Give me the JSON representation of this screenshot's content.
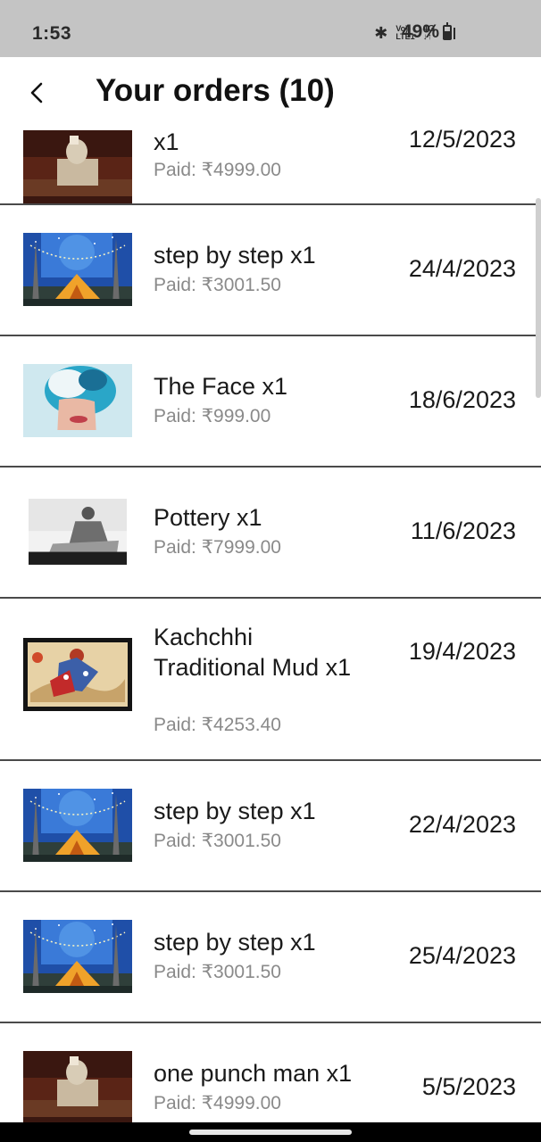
{
  "status_bar": {
    "time": "1:53",
    "volte_line1": "Vo))",
    "volte_line2": "LTE1",
    "net_line1": "4G",
    "net_line2": "↓↑",
    "battery": "49%"
  },
  "header": {
    "title": "Your orders (10)"
  },
  "orders": [
    {
      "title": "x1",
      "paid": "Paid: ₹4999.00",
      "date": "12/5/2023",
      "thumb": "sculpture-photo"
    },
    {
      "title": "step by step  x1",
      "paid": "Paid: ₹3001.50",
      "date": "24/4/2023",
      "thumb": "camping-painting"
    },
    {
      "title": "The Face  x1",
      "paid": "Paid: ₹999.00",
      "date": "18/6/2023",
      "thumb": "face-painting"
    },
    {
      "title": "Pottery  x1",
      "paid": "Paid: ₹7999.00",
      "date": "11/6/2023",
      "thumb": "pottery-photo"
    },
    {
      "title": "Kachchhi Traditional Mud x1",
      "paid": "Paid: ₹4253.40",
      "date": "19/4/2023",
      "thumb": "mud-art"
    },
    {
      "title": "step by step  x1",
      "paid": "Paid: ₹3001.50",
      "date": "22/4/2023",
      "thumb": "camping-painting"
    },
    {
      "title": "step by step  x1",
      "paid": "Paid: ₹3001.50",
      "date": "25/4/2023",
      "thumb": "camping-painting"
    },
    {
      "title": "one punch man  x1",
      "paid": "Paid: ₹4999.00",
      "date": "5/5/2023",
      "thumb": "sculpture-photo"
    }
  ],
  "colors": {
    "status_bar_bg": "#c4c4c4",
    "divider": "#4a4a4a",
    "paid_text": "#8a8a8a"
  }
}
